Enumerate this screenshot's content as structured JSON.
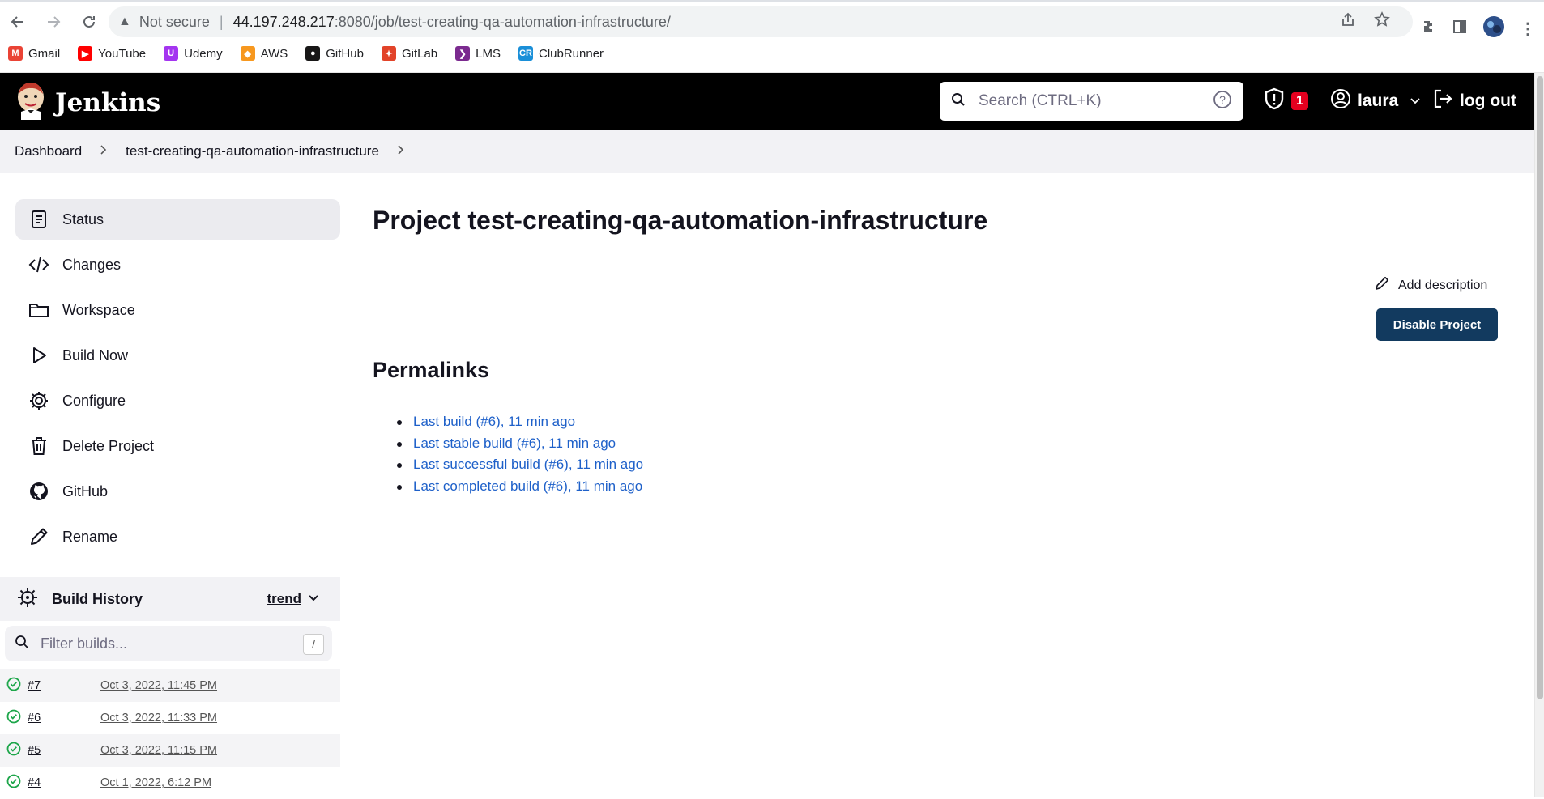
{
  "browser": {
    "security_label": "Not secure",
    "url_host": "44.197.248.217",
    "url_path": ":8080/job/test-creating-qa-automation-infrastructure/",
    "bookmarks": [
      {
        "label": "Gmail",
        "icon": "gmail-icon",
        "color": "#ea4335"
      },
      {
        "label": "YouTube",
        "icon": "youtube-icon",
        "color": "#ff0000"
      },
      {
        "label": "Udemy",
        "icon": "udemy-icon",
        "color": "#a435f0"
      },
      {
        "label": "AWS",
        "icon": "aws-icon",
        "color": "#f7981f"
      },
      {
        "label": "GitHub",
        "icon": "github-icon",
        "color": "#181717"
      },
      {
        "label": "GitLab",
        "icon": "gitlab-icon",
        "color": "#e24329"
      },
      {
        "label": "LMS",
        "icon": "lms-icon",
        "color": "#7b2a8f"
      },
      {
        "label": "ClubRunner",
        "icon": "clubrunner-icon",
        "color": "#1a8fd8"
      }
    ]
  },
  "header": {
    "app_name": "Jenkins",
    "search_placeholder": "Search (CTRL+K)",
    "security_count": "1",
    "user": "laura",
    "logout": "log out"
  },
  "breadcrumb": {
    "items": [
      "Dashboard",
      "test-creating-qa-automation-infrastructure"
    ]
  },
  "sidebar": {
    "tasks": [
      {
        "label": "Status",
        "icon": "status-icon"
      },
      {
        "label": "Changes",
        "icon": "code-icon"
      },
      {
        "label": "Workspace",
        "icon": "folder-icon"
      },
      {
        "label": "Build Now",
        "icon": "play-icon"
      },
      {
        "label": "Configure",
        "icon": "gear-icon"
      },
      {
        "label": "Delete Project",
        "icon": "trash-icon"
      },
      {
        "label": "GitHub",
        "icon": "github-icon"
      },
      {
        "label": "Rename",
        "icon": "pencil-icon"
      }
    ]
  },
  "build_history": {
    "title": "Build History",
    "trend": "trend",
    "filter_placeholder": "Filter builds...",
    "filter_shortcut": "/",
    "builds": [
      {
        "number": "#7",
        "date": "Oct 3, 2022, 11:45 PM"
      },
      {
        "number": "#6",
        "date": "Oct 3, 2022, 11:33 PM"
      },
      {
        "number": "#5",
        "date": "Oct 3, 2022, 11:15 PM"
      },
      {
        "number": "#4",
        "date": "Oct 1, 2022, 6:12 PM"
      }
    ]
  },
  "main": {
    "title": "Project test-creating-qa-automation-infrastructure",
    "add_description": "Add description",
    "disable_button": "Disable Project",
    "permalinks_heading": "Permalinks",
    "permalinks": [
      "Last build (#6), 11 min ago",
      "Last stable build (#6), 11 min ago",
      "Last successful build (#6), 11 min ago",
      "Last completed build (#6), 11 min ago"
    ]
  },
  "colors": {
    "header_bg": "#000000",
    "button_bg": "#123a5f",
    "link": "#1e60c9",
    "success": "#1ea64b",
    "badge": "#e6001f"
  }
}
